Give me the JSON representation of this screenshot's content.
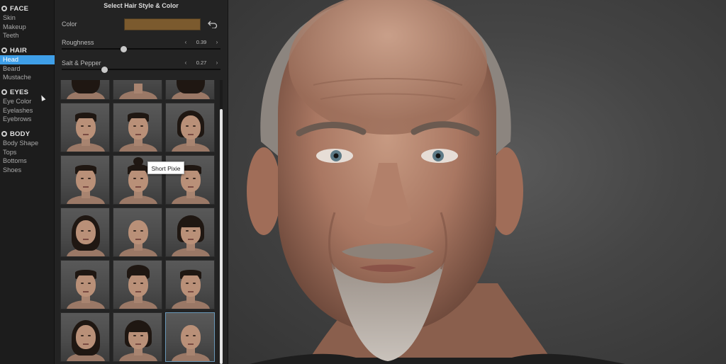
{
  "sidebar": {
    "face": {
      "title": "FACE",
      "items": [
        "Skin",
        "Makeup",
        "Teeth"
      ]
    },
    "hair": {
      "title": "HAIR",
      "items": [
        "Head",
        "Beard",
        "Mustache"
      ],
      "active": "Head"
    },
    "eyes": {
      "title": "EYES",
      "items": [
        "Eye Color",
        "Eyelashes",
        "Eyebrows"
      ]
    },
    "body": {
      "title": "BODY",
      "items": [
        "Body Shape",
        "Tops",
        "Bottoms",
        "Shoes"
      ]
    },
    "accent_color": "#3f9fe8"
  },
  "panel": {
    "title": "Select Hair Style & Color",
    "color": {
      "label": "Color",
      "value": "#7b5a2e",
      "reset_icon": "undo-icon"
    },
    "roughness": {
      "label": "Roughness",
      "value": "0.39",
      "fraction": 0.39
    },
    "salt_pepper": {
      "label": "Salt & Pepper",
      "value": "0.27",
      "fraction": 0.27
    },
    "tooltip": "Short Pixie",
    "selected_index": 17,
    "thumb_count": 18
  },
  "viewport": {
    "subject": "bald-older-man-with-goatee-render"
  }
}
